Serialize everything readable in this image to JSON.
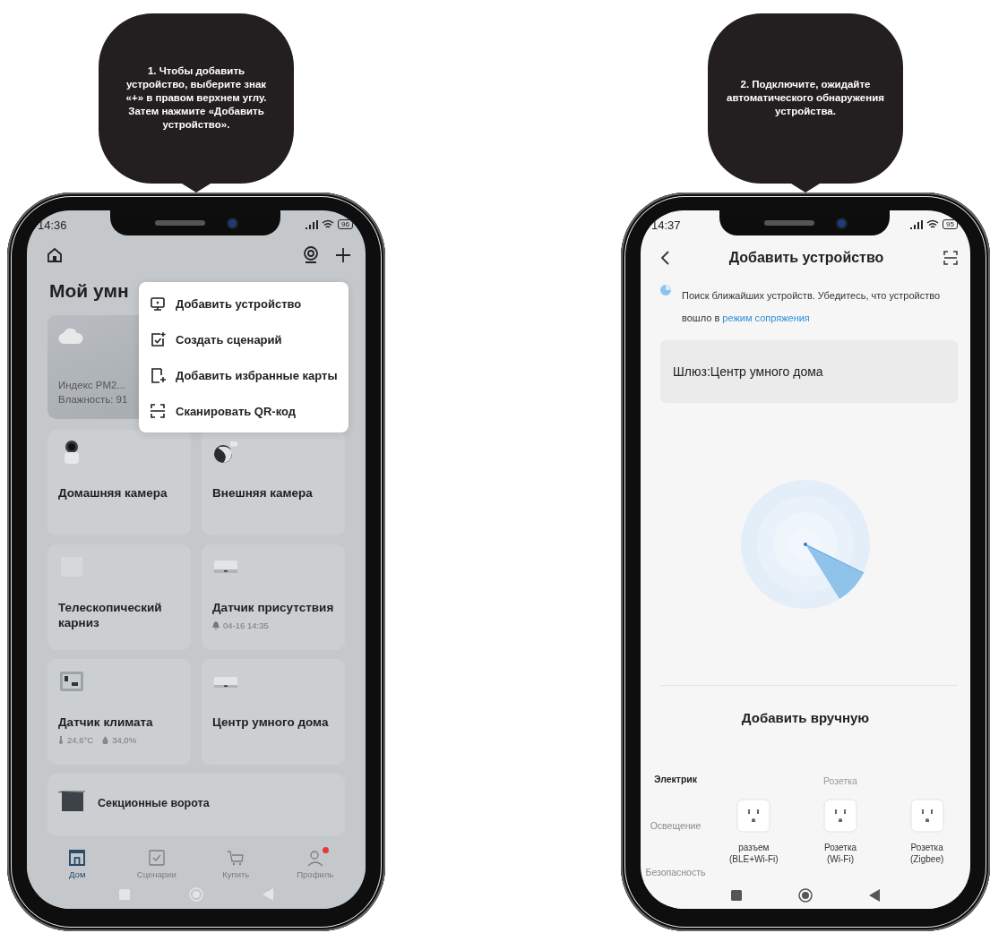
{
  "callouts": [
    {
      "text": "1. Чтобы добавить устройство, выберите знак «+» в правом верхнем углу. Затем нажмите «Добавить устройство»."
    },
    {
      "text": "2. Подключите, ожидайте автоматического обнаружения устройства."
    }
  ],
  "home_screen": {
    "status_bar": {
      "time": "14:36",
      "battery": "96"
    },
    "title": "Мой умн",
    "weather_card": {
      "lines": [
        "Индекс PM2...",
        "Влажность: 91"
      ]
    },
    "menu": {
      "items": [
        {
          "label": "Добавить устройство"
        },
        {
          "label": "Создать сценарий"
        },
        {
          "label": "Добавить избранные карты"
        },
        {
          "label": "Сканировать QR-код"
        }
      ]
    },
    "devices": [
      {
        "name": "Домашняя камера"
      },
      {
        "name": "Внешняя камера"
      },
      {
        "name": "Телескопический карниз"
      },
      {
        "name": "Датчик присутствия",
        "detail": "04-16 14:35"
      },
      {
        "name": "Датчик климата",
        "readings": [
          "24,6°C",
          "34,0%"
        ]
      },
      {
        "name": "Центр умного дома"
      }
    ],
    "gate_card": {
      "name": "Секционные ворота"
    },
    "tab_bar": [
      {
        "label": "Дом",
        "selected": true,
        "notification": false
      },
      {
        "label": "Сценарии",
        "selected": false,
        "notification": false
      },
      {
        "label": "Купить",
        "selected": false,
        "notification": false
      },
      {
        "label": "Профиль",
        "selected": false,
        "notification": true
      }
    ]
  },
  "add_device_screen": {
    "status_bar": {
      "time": "14:37",
      "battery": "95"
    },
    "title": "Добавить устройство",
    "hint": {
      "text": "Поиск ближайших устройств. Убедитесь, что устройство вошло в ",
      "link": "режим сопряжения"
    },
    "gateway": "Шлюз:Центр умного дома",
    "manual_title": "Добавить вручную",
    "categories": [
      {
        "label": "Электрик",
        "selected": true
      },
      {
        "label": "Освещение",
        "selected": false
      },
      {
        "label": "Безопасность",
        "selected": false
      }
    ],
    "section_title": "Розетка",
    "products": [
      {
        "lines": [
          "разъем",
          "(BLE+Wi-Fi)"
        ]
      },
      {
        "lines": [
          "Розетка",
          "(Wi-Fi)"
        ]
      },
      {
        "lines": [
          "Розетка",
          "(Zigbee)"
        ]
      }
    ]
  }
}
